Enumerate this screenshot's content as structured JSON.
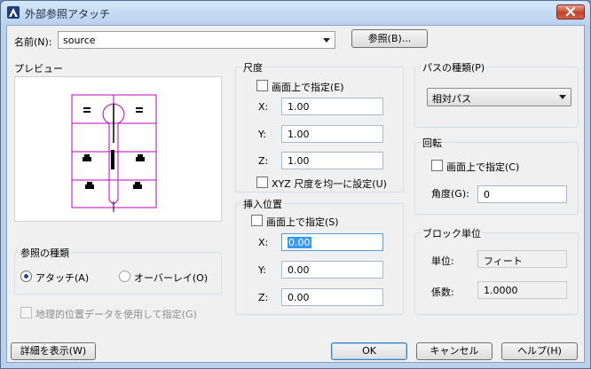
{
  "window": {
    "title": "外部参照アタッチ"
  },
  "name_row": {
    "label": "名前(N):",
    "value": "source",
    "browse_button": "参照(B)..."
  },
  "preview": {
    "title": "プレビュー"
  },
  "reference_type": {
    "title": "参照の種類",
    "attach_label": "アタッチ(A)",
    "overlay_label": "オーバーレイ(O)",
    "selected": "attach"
  },
  "geo_checkbox": {
    "label": "地理的位置データを使用して指定(G)"
  },
  "scale": {
    "title": "尺度",
    "specify_on_screen": "画面上で指定(E)",
    "x_label": "X:",
    "x_value": "1.00",
    "y_label": "Y:",
    "y_value": "1.00",
    "z_label": "Z:",
    "z_value": "1.00",
    "uniform_label": "XYZ 尺度を均一に設定(U)"
  },
  "insertion": {
    "title": "挿入位置",
    "specify_on_screen": "画面上で指定(S)",
    "x_label": "X:",
    "x_value": "0.00",
    "y_label": "Y:",
    "y_value": "0.00",
    "z_label": "Z:",
    "z_value": "0.00"
  },
  "path_type": {
    "title": "パスの種類(P)",
    "value": "相対パス"
  },
  "rotation": {
    "title": "回転",
    "specify_on_screen": "画面上で指定(C)",
    "angle_label": "角度(G):",
    "angle_value": "0"
  },
  "block_unit": {
    "title": "ブロック単位",
    "unit_label": "単位:",
    "unit_value": "フィート",
    "factor_label": "係数:",
    "factor_value": "1.0000"
  },
  "footer": {
    "details_button": "詳細を表示(W)",
    "ok_button": "OK",
    "cancel_button": "キャンセル",
    "help_button": "ヘルプ(H)"
  },
  "colors": {
    "preview_lines": "#c000c0",
    "title_bar": "#b9d1ee",
    "close_button": "#c4412a"
  }
}
